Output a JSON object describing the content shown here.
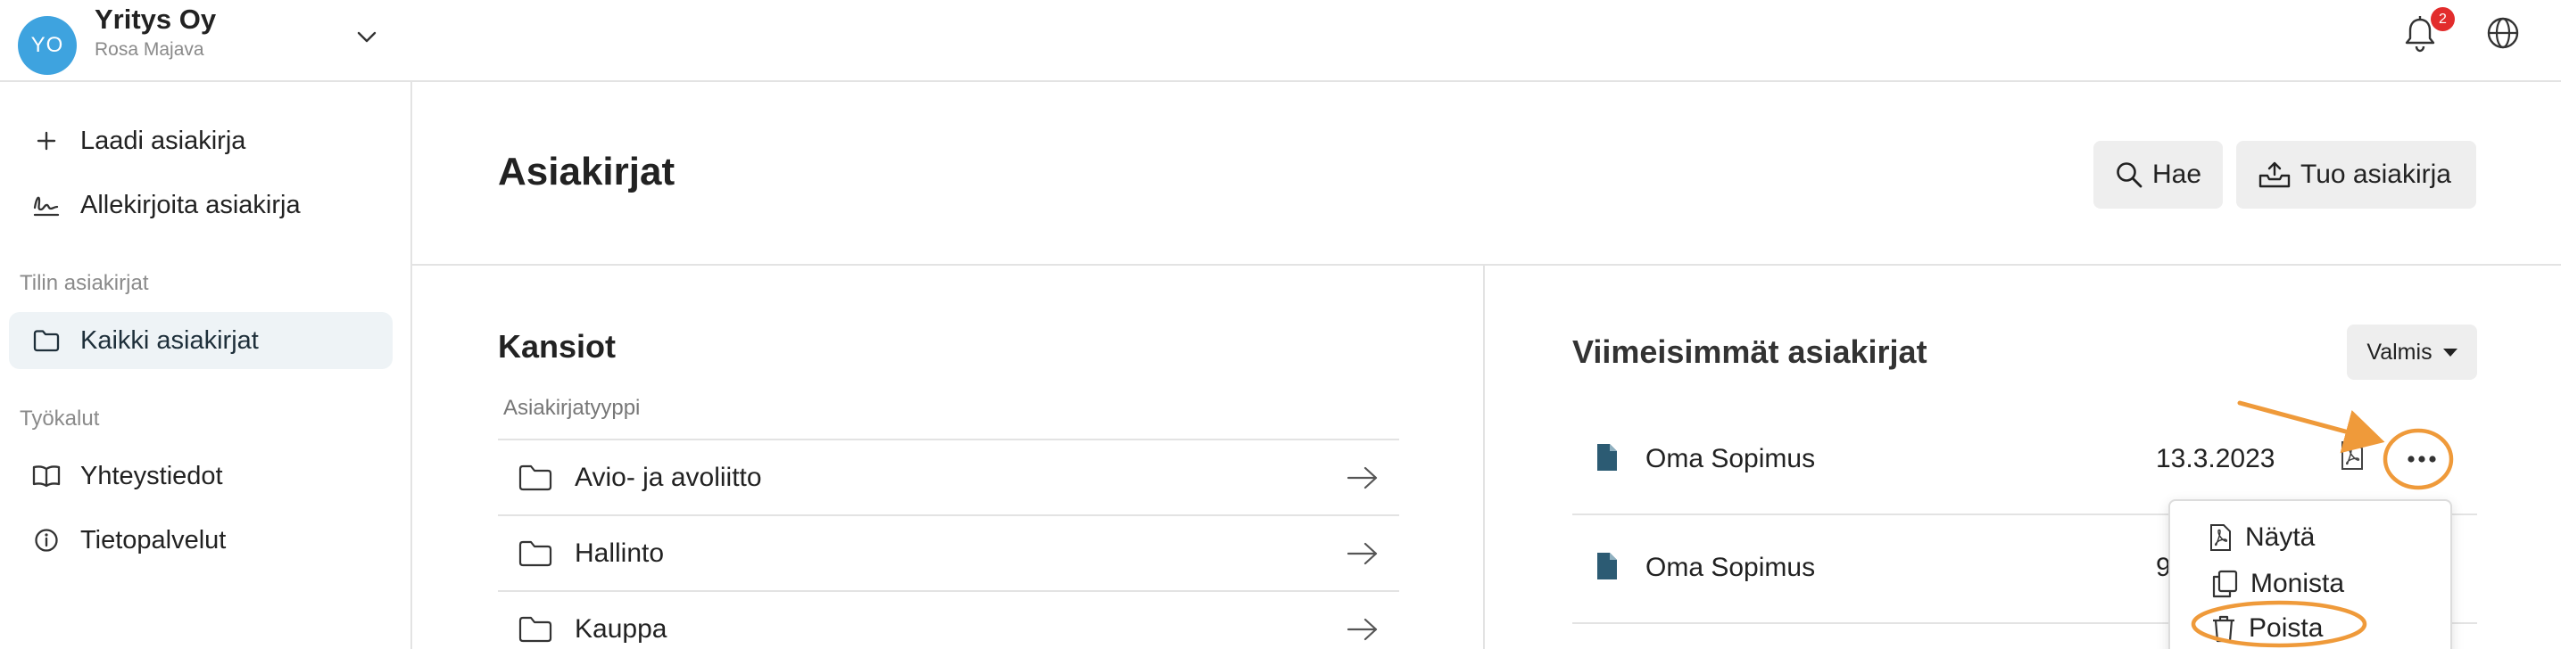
{
  "header": {
    "avatar_initials": "YO",
    "org_name": "Yritys Oy",
    "user_name": "Rosa Majava",
    "notification_count": "2"
  },
  "sidebar": {
    "actions": [
      {
        "label": "Laadi asiakirja",
        "icon": "plus-icon"
      },
      {
        "label": "Allekirjoita asiakirja",
        "icon": "signature-icon"
      }
    ],
    "section_account": "Tilin asiakirjat",
    "account_items": [
      {
        "label": "Kaikki asiakirjat",
        "icon": "folder-icon",
        "active": true
      }
    ],
    "section_tools": "Työkalut",
    "tool_items": [
      {
        "label": "Yhteystiedot",
        "icon": "book-icon"
      },
      {
        "label": "Tietopalvelut",
        "icon": "info-icon"
      }
    ]
  },
  "main": {
    "title": "Asiakirjat",
    "search_label": "Hae",
    "import_label": "Tuo asiakirja"
  },
  "folders": {
    "title": "Kansiot",
    "column_label": "Asiakirjatyyppi",
    "items": [
      "Avio- ja avoliitto",
      "Hallinto",
      "Kauppa"
    ]
  },
  "recent": {
    "title": "Viimeisimmät asiakirjat",
    "status_filter": "Valmis",
    "documents": [
      {
        "name": "Oma Sopimus",
        "date": "13.3.2023"
      },
      {
        "name": "Oma Sopimus",
        "date": "9."
      }
    ],
    "menu": {
      "view": "Näytä",
      "copy": "Monista",
      "delete": "Poista"
    }
  },
  "colors": {
    "avatar": "#3ea3df",
    "badge": "#e22c2c",
    "doc_icon": "#2c5b73",
    "annotation": "#ef9a3a",
    "active_bg": "#eef3f6"
  }
}
